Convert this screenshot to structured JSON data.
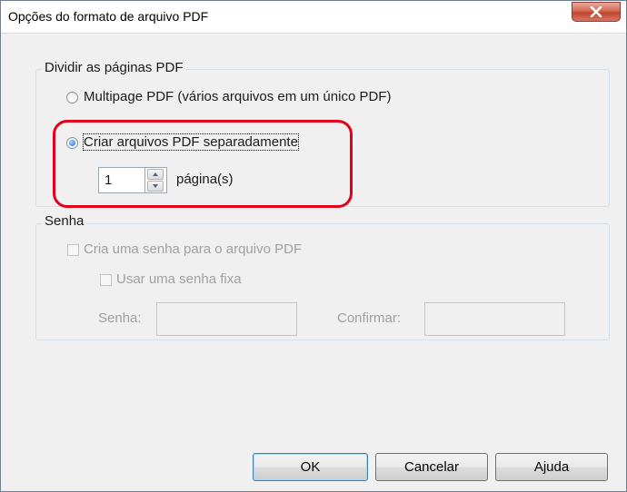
{
  "window": {
    "title": "Opções do formato de arquivo PDF"
  },
  "split_group": {
    "label": "Dividir as páginas PDF",
    "option_multipage": "Multipage PDF (vários arquivos em um único PDF)",
    "option_separate": "Criar arquivos PDF separadamente",
    "selected": "option_separate",
    "pages_value": "1",
    "pages_unit": "página(s)"
  },
  "password_group": {
    "label": "Senha",
    "create_password": "Cria uma senha para o arquivo PDF",
    "fixed_password": "Usar uma senha fixa",
    "password_label": "Senha:",
    "confirm_label": "Confirmar:",
    "password_value": "",
    "confirm_value": ""
  },
  "buttons": {
    "ok": "OK",
    "cancel": "Cancelar",
    "help": "Ajuda"
  },
  "colors": {
    "highlight": "#e3001b",
    "disabled_text": "#a0a0a0"
  }
}
